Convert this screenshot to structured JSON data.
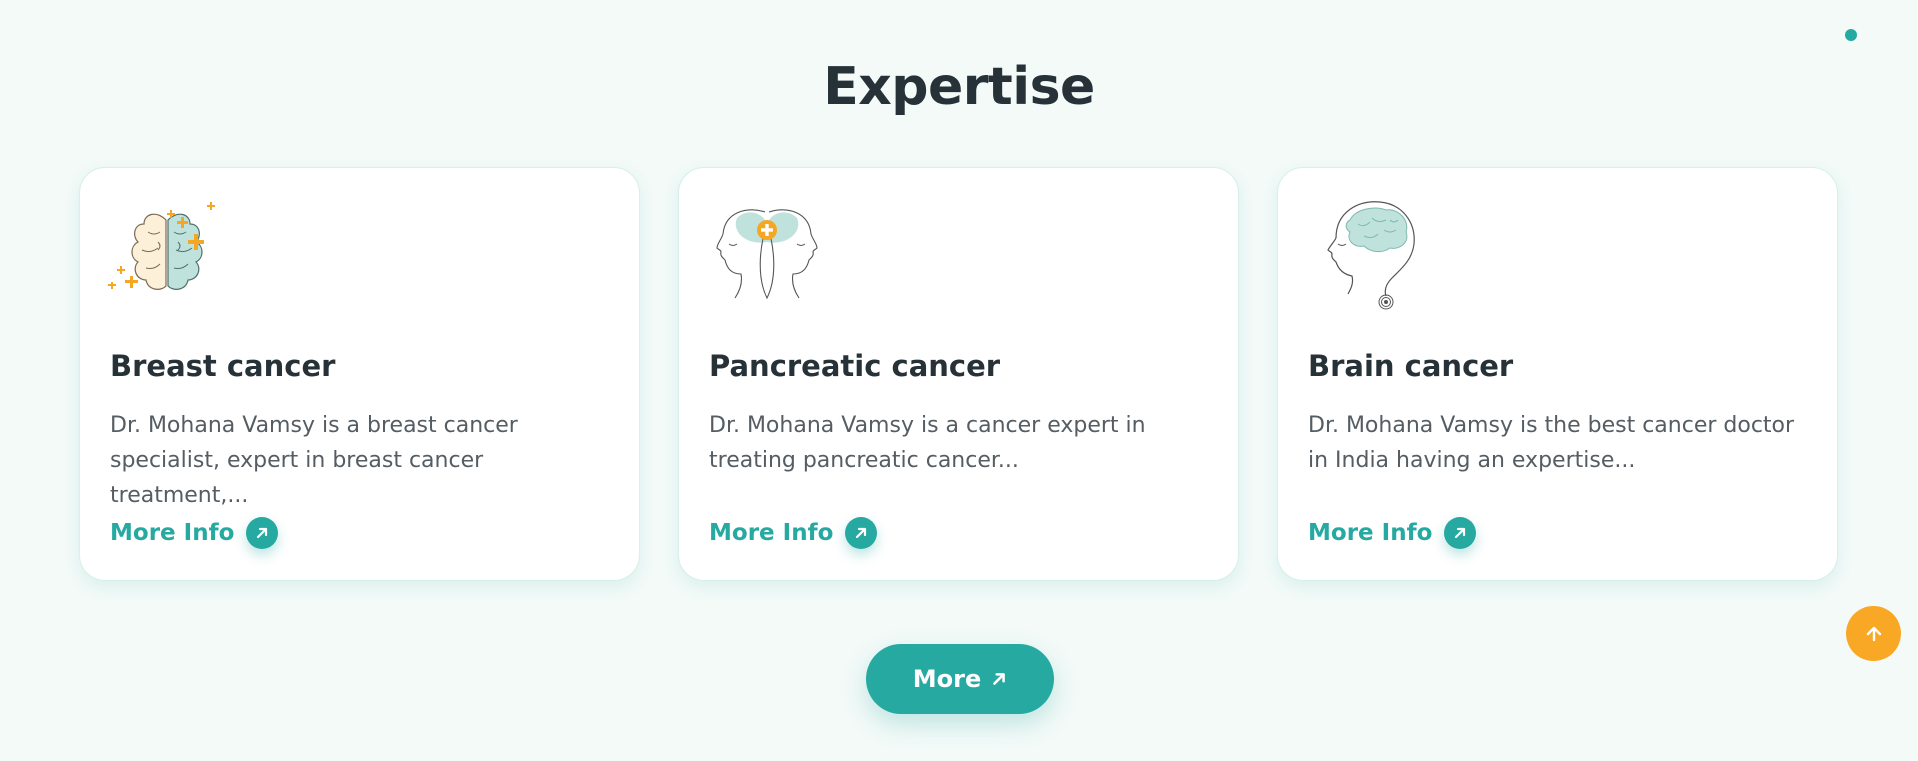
{
  "section": {
    "title": "Expertise"
  },
  "cards": [
    {
      "title": "Breast cancer",
      "description": "Dr. Mohana Vamsy is a breast cancer specialist, expert in breast cancer treatment,...",
      "link_label": "More Info",
      "icon": "brain-sparkle-icon"
    },
    {
      "title": "Pancreatic cancer",
      "description": "Dr. Mohana Vamsy is a cancer expert in treating pancreatic cancer...",
      "link_label": "More Info",
      "icon": "two-faces-pancreas-icon"
    },
    {
      "title": "Brain cancer",
      "description": "Dr. Mohana Vamsy is the best cancer doctor in India having an expertise...",
      "link_label": "More Info",
      "icon": "head-brain-icon"
    }
  ],
  "more_button": {
    "label": "More"
  },
  "colors": {
    "background": "#f3faf8",
    "accent": "#26a9a1",
    "scroll_top": "#f9a825",
    "title": "#263238",
    "body_text": "#555d63"
  }
}
